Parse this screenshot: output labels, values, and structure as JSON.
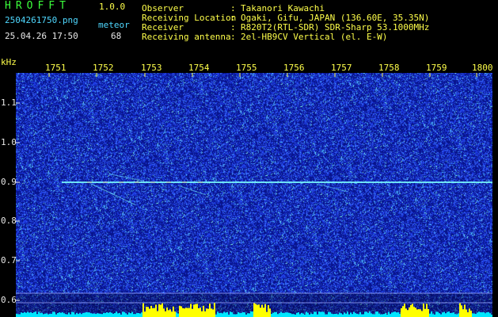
{
  "app": {
    "title": "HROFFT",
    "version": "1.0.0",
    "file_name": "2504261750.png",
    "timestamp": "25.04.26 17:50",
    "meteor_label": "meteor",
    "meteor_count": "68"
  },
  "info": [
    {
      "label": "Observer",
      "value": "Takanori Kawachi"
    },
    {
      "label": "Receiving Location",
      "value": "Ogaki, Gifu, JAPAN (136.60E, 35.35N)"
    },
    {
      "label": "Receiver",
      "value": "R820T2(RTL-SDR) SDR-Sharp 53.1000MHz"
    },
    {
      "label": "Receiving antenna",
      "value": "2el-HB9CV Vertical (el. E-W)"
    }
  ],
  "axis": {
    "unit": "kHz",
    "time_ticks": [
      "1751",
      "1752",
      "1753",
      "1754",
      "1755",
      "1756",
      "1757",
      "1758",
      "1759",
      "1800"
    ],
    "freq_ticks": [
      "1.1",
      "1.0",
      "0.9",
      "0.8",
      "0.7",
      "0.6"
    ]
  },
  "colors": {
    "background": "#000000",
    "noise_dark": "#0a1a8c",
    "noise_light": "#3a5cff",
    "signal": "#7dffff",
    "signal_hot": "#ff5a3c",
    "label_yellow": "#ffff4a",
    "label_green": "#3cff3c",
    "label_cyan": "#4fd8ff",
    "meter_yellow": "#ffff00",
    "meter_cyan": "#00e6ff"
  }
}
